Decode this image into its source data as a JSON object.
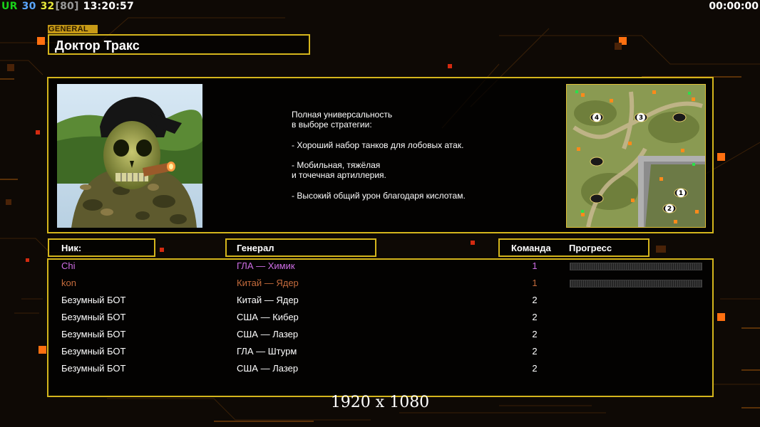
{
  "hud": {
    "stats": [
      {
        "text": "UR",
        "color": "#19d119"
      },
      {
        "text": "30",
        "color": "#5aa6ff"
      },
      {
        "text": "32",
        "color": "#e8e83a"
      },
      {
        "text": "[80]",
        "color": "#9a9a9a"
      },
      {
        "text": "13:20:57",
        "color": "#ffffff"
      }
    ],
    "timer": "00:00:00"
  },
  "general": {
    "tag": "GENERAL",
    "name": "Доктор Тракс",
    "description": [
      "Полная универсальность",
      "в выборе стратегии:",
      "",
      "- Хороший набор танков для лобовых атак.",
      "",
      "- Мобильная, тяжёлая",
      "и точечная артиллерия.",
      "",
      "- Высокий общий урон благодаря кислотам."
    ]
  },
  "minimap": {
    "spawn_labels": [
      "4",
      "3",
      "1",
      "2"
    ]
  },
  "columns": {
    "nick": "Ник:",
    "general": "Генерал",
    "team": "Команда",
    "progress": "Прогресс"
  },
  "players": [
    {
      "nick": "Chi",
      "general": "ГЛА — Химик",
      "team": "1",
      "color": "#cf6ee6",
      "has_progress": true
    },
    {
      "nick": "kon",
      "general": "Китай — Ядер",
      "team": "1",
      "color": "#c46b3c",
      "has_progress": true
    },
    {
      "nick": "Безумный БОТ",
      "general": "Китай — Ядер",
      "team": "2",
      "color": "#ffffff",
      "has_progress": false
    },
    {
      "nick": "Безумный БОТ",
      "general": "США — Кибер",
      "team": "2",
      "color": "#ffffff",
      "has_progress": false
    },
    {
      "nick": "Безумный БОТ",
      "general": "США — Лазер",
      "team": "2",
      "color": "#ffffff",
      "has_progress": false
    },
    {
      "nick": "Безумный БОТ",
      "general": "ГЛА — Штурм",
      "team": "2",
      "color": "#ffffff",
      "has_progress": false
    },
    {
      "nick": "Безумный БОТ",
      "general": "США — Лазер",
      "team": "2",
      "color": "#ffffff",
      "has_progress": false
    }
  ],
  "resolution": "1920 x 1080",
  "colors": {
    "frame": "#d4b51c",
    "accent": "#ff7a1a",
    "background": "#0e0905"
  }
}
